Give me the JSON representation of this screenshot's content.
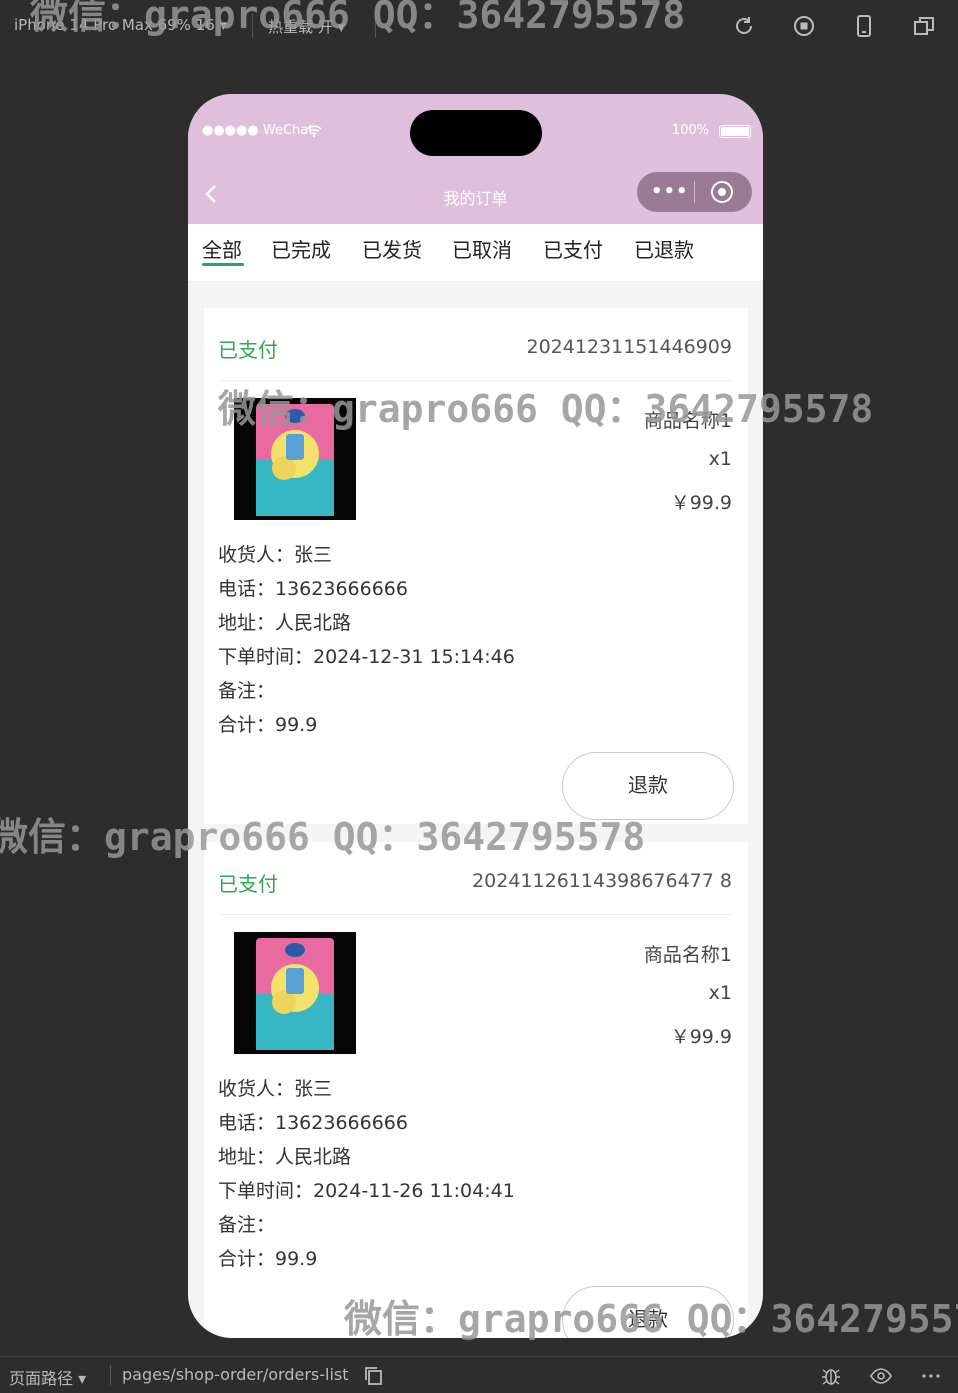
{
  "toolbar": {
    "device": "iPhone 14 Pro Max 69% 16 ▾",
    "hot_reload": "热重载 开 ▾"
  },
  "status_bar": {
    "carrier": "●●●●● WeChat",
    "battery": "100%"
  },
  "nav": {
    "title": "我的订单",
    "more": "•••"
  },
  "tabs": [
    {
      "label": "全部",
      "active": true
    },
    {
      "label": "已完成"
    },
    {
      "label": "已发货"
    },
    {
      "label": "已取消"
    },
    {
      "label": "已支付"
    },
    {
      "label": "已退款"
    }
  ],
  "orders": [
    {
      "status": "已支付",
      "order_no": "20241231151446909",
      "product_name": "商品名称1",
      "qty": "x1",
      "price": "￥99.9",
      "consignee": "收货人：张三",
      "phone": "电话：13623666666",
      "address": "地址：人民北路",
      "order_time": "下单时间：2024-12-31 15:14:46",
      "remark": "备注：",
      "total": "合计：99.9",
      "button": "退款"
    },
    {
      "status": "已支付",
      "order_no": "20241126114398676477 8",
      "product_name": "商品名称1",
      "qty": "x1",
      "price": "￥99.9",
      "consignee": "收货人：张三",
      "phone": "电话：13623666666",
      "address": "地址：人民北路",
      "order_time": "下单时间：2024-11-26 11:04:41",
      "remark": "备注：",
      "total": "合计：99.9",
      "button": "退款"
    }
  ],
  "bottom_bar": {
    "label": "页面路径 ▾",
    "path": "pages/shop-order/orders-list"
  },
  "watermark": "微信：grapro666 QQ：3642795578",
  "colors": {
    "header": "#e0bfdc",
    "status_green": "#2fa84f",
    "tab_underline": "#1aad5a",
    "chrome": "#2d2d2d"
  }
}
